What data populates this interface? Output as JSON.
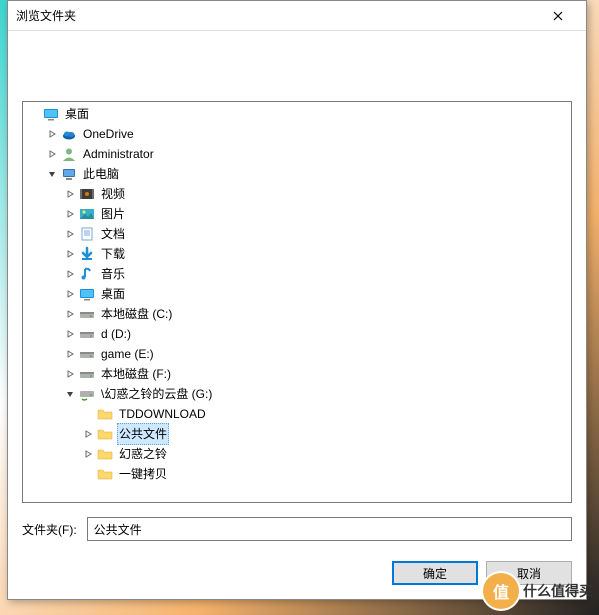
{
  "dialog": {
    "title": "浏览文件夹",
    "close_tooltip": "关闭"
  },
  "tree": {
    "nodes": [
      {
        "depth": 0,
        "expander": "none",
        "icon": "desktop",
        "label": "桌面"
      },
      {
        "depth": 1,
        "expander": "closed",
        "icon": "onedrive",
        "label": "OneDrive"
      },
      {
        "depth": 1,
        "expander": "closed",
        "icon": "user",
        "label": "Administrator"
      },
      {
        "depth": 1,
        "expander": "open",
        "icon": "pc",
        "label": "此电脑"
      },
      {
        "depth": 2,
        "expander": "closed",
        "icon": "video",
        "label": "视频"
      },
      {
        "depth": 2,
        "expander": "closed",
        "icon": "pictures",
        "label": "图片"
      },
      {
        "depth": 2,
        "expander": "closed",
        "icon": "documents",
        "label": "文档"
      },
      {
        "depth": 2,
        "expander": "closed",
        "icon": "downloads",
        "label": "下载"
      },
      {
        "depth": 2,
        "expander": "closed",
        "icon": "music",
        "label": "音乐"
      },
      {
        "depth": 2,
        "expander": "closed",
        "icon": "desktop",
        "label": "桌面"
      },
      {
        "depth": 2,
        "expander": "closed",
        "icon": "drive",
        "label": "本地磁盘 (C:)"
      },
      {
        "depth": 2,
        "expander": "closed",
        "icon": "drive",
        "label": "d (D:)"
      },
      {
        "depth": 2,
        "expander": "closed",
        "icon": "drive",
        "label": "game (E:)"
      },
      {
        "depth": 2,
        "expander": "closed",
        "icon": "drive",
        "label": "本地磁盘 (F:)"
      },
      {
        "depth": 2,
        "expander": "open",
        "icon": "netdrive",
        "label": "\\幻惑之铃的云盘 (G:)"
      },
      {
        "depth": 3,
        "expander": "none",
        "icon": "folder",
        "label": "TDDOWNLOAD"
      },
      {
        "depth": 3,
        "expander": "closed",
        "icon": "folder",
        "label": "公共文件",
        "selected": true
      },
      {
        "depth": 3,
        "expander": "closed",
        "icon": "folder",
        "label": "幻惑之铃"
      },
      {
        "depth": 3,
        "expander": "none",
        "icon": "folder",
        "label": "一键拷贝"
      }
    ]
  },
  "folder_field": {
    "label": "文件夹(F):",
    "value": "公共文件"
  },
  "buttons": {
    "ok": "确定",
    "cancel": "取消"
  },
  "watermark": {
    "circle": "值",
    "text": "什么值得买"
  }
}
